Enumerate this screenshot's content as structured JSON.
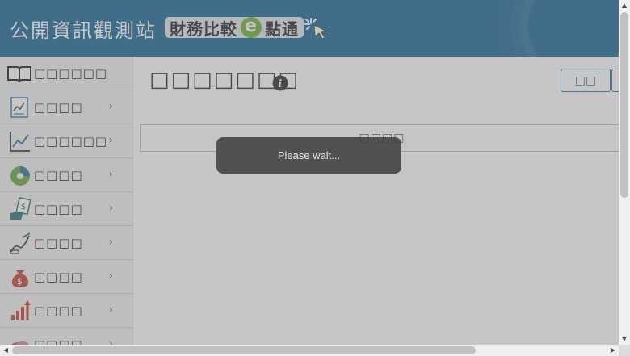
{
  "header": {
    "site_title": "公開資訊觀測站",
    "sub_title": "財務比較",
    "sub_e": "e",
    "sub_title_suffix": "點通",
    "bg_color": "#0b5d8e"
  },
  "sidebar": {
    "head_label": "□□□□□□",
    "items": [
      {
        "label": "□□□□",
        "icon": "report-chart-icon"
      },
      {
        "label": "□□□□□□",
        "icon": "line-chart-icon"
      },
      {
        "label": "□□□□",
        "icon": "pie-chart-icon"
      },
      {
        "label": "□□□□",
        "icon": "money-hand-icon"
      },
      {
        "label": "□□□□",
        "icon": "sign-document-icon"
      },
      {
        "label": "□□□□",
        "icon": "money-bag-icon"
      },
      {
        "label": "□□□□",
        "icon": "bar-growth-icon"
      },
      {
        "label": "□□□□",
        "icon": "coins-icon"
      }
    ],
    "chevron": "›"
  },
  "main": {
    "page_title": "□□□□□□□",
    "query_button": "□□",
    "table_header": "□□□□"
  },
  "overlay": {
    "wait_text": "Please wait..."
  },
  "scrollbars": {
    "up": "▲",
    "down": "▼",
    "left": "◀",
    "right": "▶"
  }
}
